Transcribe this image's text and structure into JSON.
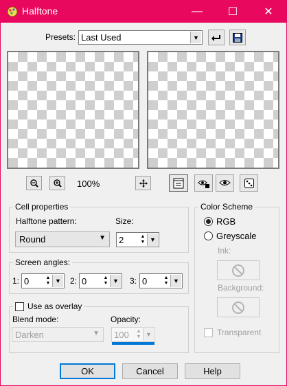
{
  "window": {
    "title": "Halftone",
    "minimize_glyph": "—",
    "maximize_glyph": "☐",
    "close_glyph": "✕"
  },
  "presets": {
    "label": "Presets:",
    "value": "Last Used"
  },
  "zoom": {
    "level": "100%"
  },
  "cell_properties": {
    "title": "Cell properties",
    "pattern_label": "Halftone pattern:",
    "pattern_value": "Round",
    "size_label": "Size:",
    "size_value": "2"
  },
  "screen_angles": {
    "title": "Screen angles:",
    "a1_label": "1:",
    "a1_value": "0",
    "a2_label": "2:",
    "a2_value": "0",
    "a3_label": "3:",
    "a3_value": "0"
  },
  "overlay": {
    "checkbox_label": "Use as overlay",
    "checked": false,
    "blend_label": "Blend mode:",
    "blend_value": "Darken",
    "opacity_label": "Opacity:",
    "opacity_value": "100"
  },
  "color_scheme": {
    "title": "Color Scheme",
    "rgb_label": "RGB",
    "greyscale_label": "Greyscale",
    "selected": "RGB",
    "ink_label": "Ink:",
    "background_label": "Background:",
    "transparent_label": "Transparent"
  },
  "buttons": {
    "ok": "OK",
    "cancel": "Cancel",
    "help": "Help"
  },
  "colors": {
    "titlebar": "#e8085d",
    "default_button_border": "#0078d7"
  }
}
